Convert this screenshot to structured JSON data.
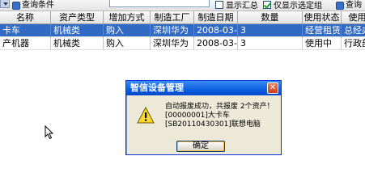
{
  "toolbar": {
    "query_label": "查询条件",
    "checkbox_summary_label": "显示汇总",
    "checkbox_select_group_label": "仅显示选定组",
    "query_button_label": "查询"
  },
  "table": {
    "columns": [
      "名称",
      "资产类型",
      "增加方式",
      "制造工厂",
      "制造日期",
      "数量",
      "使用状态",
      "使用"
    ],
    "rows": [
      {
        "name": "卡车",
        "type": "机械类",
        "method": "购入",
        "factory": "深圳华为",
        "date": "2008-03-28",
        "qty": "3",
        "status": "经营租赁",
        "use": "总经办"
      },
      {
        "name": "产机器",
        "type": "机械类",
        "method": "购入",
        "factory": "深圳华为",
        "date": "2008-03-28",
        "qty": "3",
        "status": "使用中",
        "use": "行政部"
      }
    ]
  },
  "dialog": {
    "title": "智信设备管理",
    "message_line1": "自动报废成功，共报废 2个资产！",
    "message_line2": "[00000001]大卡车",
    "message_line3": "[SB20110430301]联想电脑",
    "ok_label": "确定",
    "close_glyph": "✕"
  }
}
